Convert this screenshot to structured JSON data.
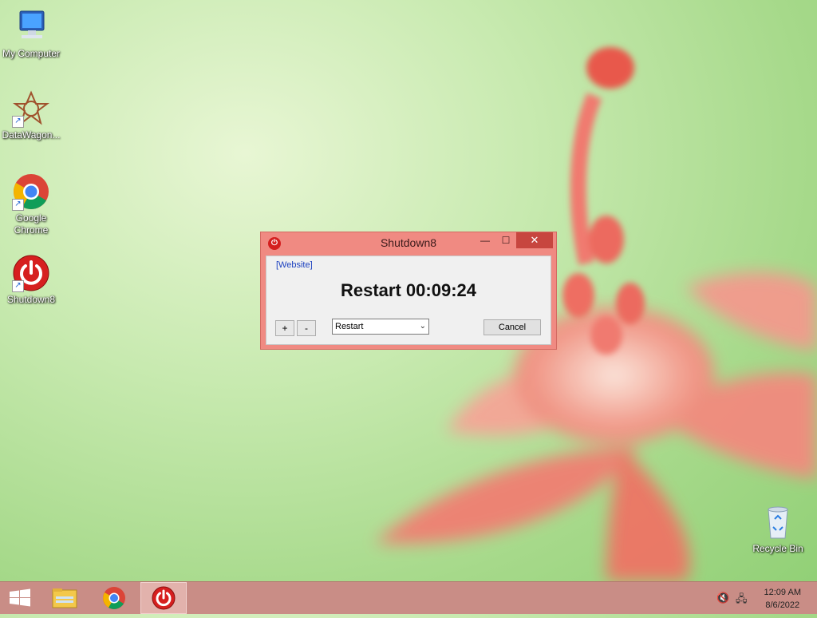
{
  "desktop": {
    "icons": [
      {
        "label": "My Computer",
        "icon": "computer-icon"
      },
      {
        "label": "DataWagon...",
        "icon": "datawagon-icon"
      },
      {
        "label": "Google Chrome",
        "icon": "chrome-icon"
      },
      {
        "label": "Shutdown8",
        "icon": "power-icon"
      },
      {
        "label": "Recycle Bin",
        "icon": "recycle-bin-icon"
      }
    ]
  },
  "window": {
    "title": "Shutdown8",
    "minimize": "—",
    "maximize": "☐",
    "close": "✕",
    "website_link": "[Website]",
    "timer_text": "Restart 00:09:24",
    "plus_label": "+",
    "minus_label": "-",
    "action_selected": "Restart",
    "cancel_label": "Cancel"
  },
  "taskbar": {
    "items": [
      {
        "icon": "windows-start-icon"
      },
      {
        "icon": "file-explorer-icon"
      },
      {
        "icon": "chrome-icon"
      },
      {
        "icon": "power-icon",
        "active": true
      }
    ],
    "tray": {
      "time": "12:09 AM",
      "date": "8/6/2022"
    }
  },
  "colors": {
    "window_frame": "#f08a82",
    "close_button": "#c7463f",
    "taskbar": "#c98d86"
  }
}
